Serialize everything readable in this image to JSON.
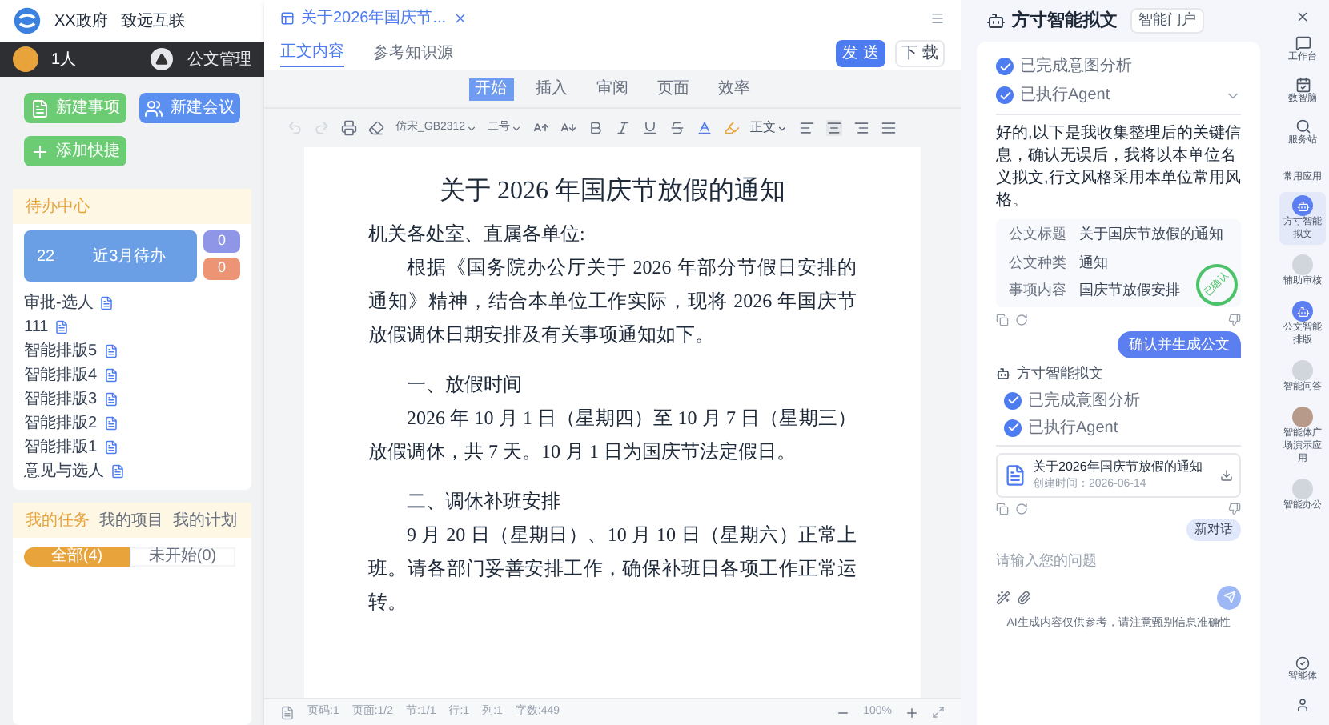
{
  "portal": {
    "org": "XX政府",
    "brand": "致远互联",
    "user_count": "1人",
    "module": "公文管理",
    "quick_buttons": [
      {
        "label": "新建事项",
        "kind": "item"
      },
      {
        "label": "新建会议",
        "kind": "meeting"
      },
      {
        "label": "添加快捷",
        "kind": "add"
      }
    ],
    "todo": {
      "title": "待办中心",
      "main_count": "22",
      "main_label": "近3月待办",
      "side_counts": [
        {
          "value": "0",
          "color": "#8f96e8"
        },
        {
          "value": "0",
          "color": "#ec9474"
        }
      ],
      "items": [
        "审批-选人",
        "111",
        "智能排版5",
        "智能排版4",
        "智能排版3",
        "智能排版2",
        "智能排版1",
        "意见与选人"
      ]
    },
    "tasks": {
      "tabs": [
        {
          "label": "我的任务",
          "selected": true
        },
        {
          "label": "我的项目",
          "selected": false
        },
        {
          "label": "我的计划",
          "selected": false
        }
      ],
      "filters": [
        {
          "label": "全部(4)",
          "selected": true
        },
        {
          "label": "未开始(0)",
          "selected": false
        }
      ]
    }
  },
  "editor": {
    "file_tab": "关于2026年国庆节...",
    "tabs": [
      {
        "label": "正文内容",
        "selected": true
      },
      {
        "label": "参考知识源",
        "selected": false
      }
    ],
    "send": "发 送",
    "download": "下 载",
    "ribbon": [
      {
        "label": "开始",
        "selected": true
      },
      {
        "label": "插入",
        "selected": false
      },
      {
        "label": "审阅",
        "selected": false
      },
      {
        "label": "页面",
        "selected": false
      },
      {
        "label": "效率",
        "selected": false
      }
    ],
    "font": "仿宋_GB2312",
    "size": "二号",
    "style": "正文",
    "document": {
      "title": "关于 2026 年国庆节放假的通知",
      "paragraphs": [
        {
          "kind": "salutation",
          "text": "机关各处室、直属各单位:"
        },
        {
          "kind": "body",
          "text": "根据《国务院办公厅关于 2026 年部分节假日安排的通知》精神，结合本单位工作实际，现将 2026 年国庆节放假调休日期安排及有关事项通知如下。"
        },
        {
          "kind": "heading",
          "text": "一、放假时间"
        },
        {
          "kind": "body",
          "text": "2026 年 10 月 1 日（星期四）至 10 月 7 日（星期三）放假调休，共 7 天。10 月 1 日为国庆节法定假日。"
        },
        {
          "kind": "heading",
          "text": "二、调休补班安排"
        },
        {
          "kind": "body",
          "text": "9 月 20 日（星期日）、10 月 10 日（星期六）正常上班。请各部门妥善安排工作，确保补班日各项工作正常运转。"
        }
      ]
    },
    "status": [
      "页码:1",
      "页面:1/2",
      "节:1/1",
      "行:1",
      "列:1",
      "字数:449"
    ],
    "zoom": "100%"
  },
  "assistant": {
    "name": "方寸智能拟文",
    "portal_button": "智能门户",
    "steps": [
      {
        "label": "已完成意图分析",
        "done": true
      },
      {
        "label": "已执行Agent",
        "done": true
      }
    ],
    "message": "好的,以下是我收集整理后的关键信息，确认无误后，我将以本单位名义拟文,行文风格采用本单位常用风格。",
    "fields": [
      {
        "label": "公文标题",
        "value": "关于国庆节放假的通知"
      },
      {
        "label": "公文种类",
        "value": "通知"
      },
      {
        "label": "事项内容",
        "value": "国庆节放假安排"
      }
    ],
    "stamp": "已确认",
    "user_message": "确认并生成公文",
    "reply_name": "方寸智能拟文",
    "reply_steps": [
      {
        "label": "已完成意图分析",
        "done": true
      },
      {
        "label": "已执行Agent",
        "done": true
      }
    ],
    "file": {
      "name": "关于2026年国庆节放假的通知",
      "created": "创建时间：2026-06-14"
    },
    "new_chat": "新对话",
    "placeholder": "请输入您的问题",
    "disclaimer": "AI生成内容仅供参考，请注意甄别信息准确性"
  },
  "rail": {
    "top": [
      {
        "label": "工作台",
        "kind": "chat"
      },
      {
        "label": "数智脑",
        "kind": "calendar"
      },
      {
        "label": "服务站",
        "kind": "search"
      }
    ],
    "section": "常用应用",
    "apps": [
      {
        "label": "方寸智能拟文",
        "kind": "bot",
        "selected": true
      },
      {
        "label": "辅助审核",
        "kind": "blank",
        "selected": false
      },
      {
        "label": "公文智能排版",
        "kind": "bot",
        "selected": false
      },
      {
        "label": "智能问答",
        "kind": "blank",
        "selected": false
      },
      {
        "label": "智能体广场演示应用",
        "kind": "photo",
        "selected": false
      },
      {
        "label": "智能办公",
        "kind": "blank",
        "selected": false
      }
    ],
    "bottom": "智能体"
  }
}
